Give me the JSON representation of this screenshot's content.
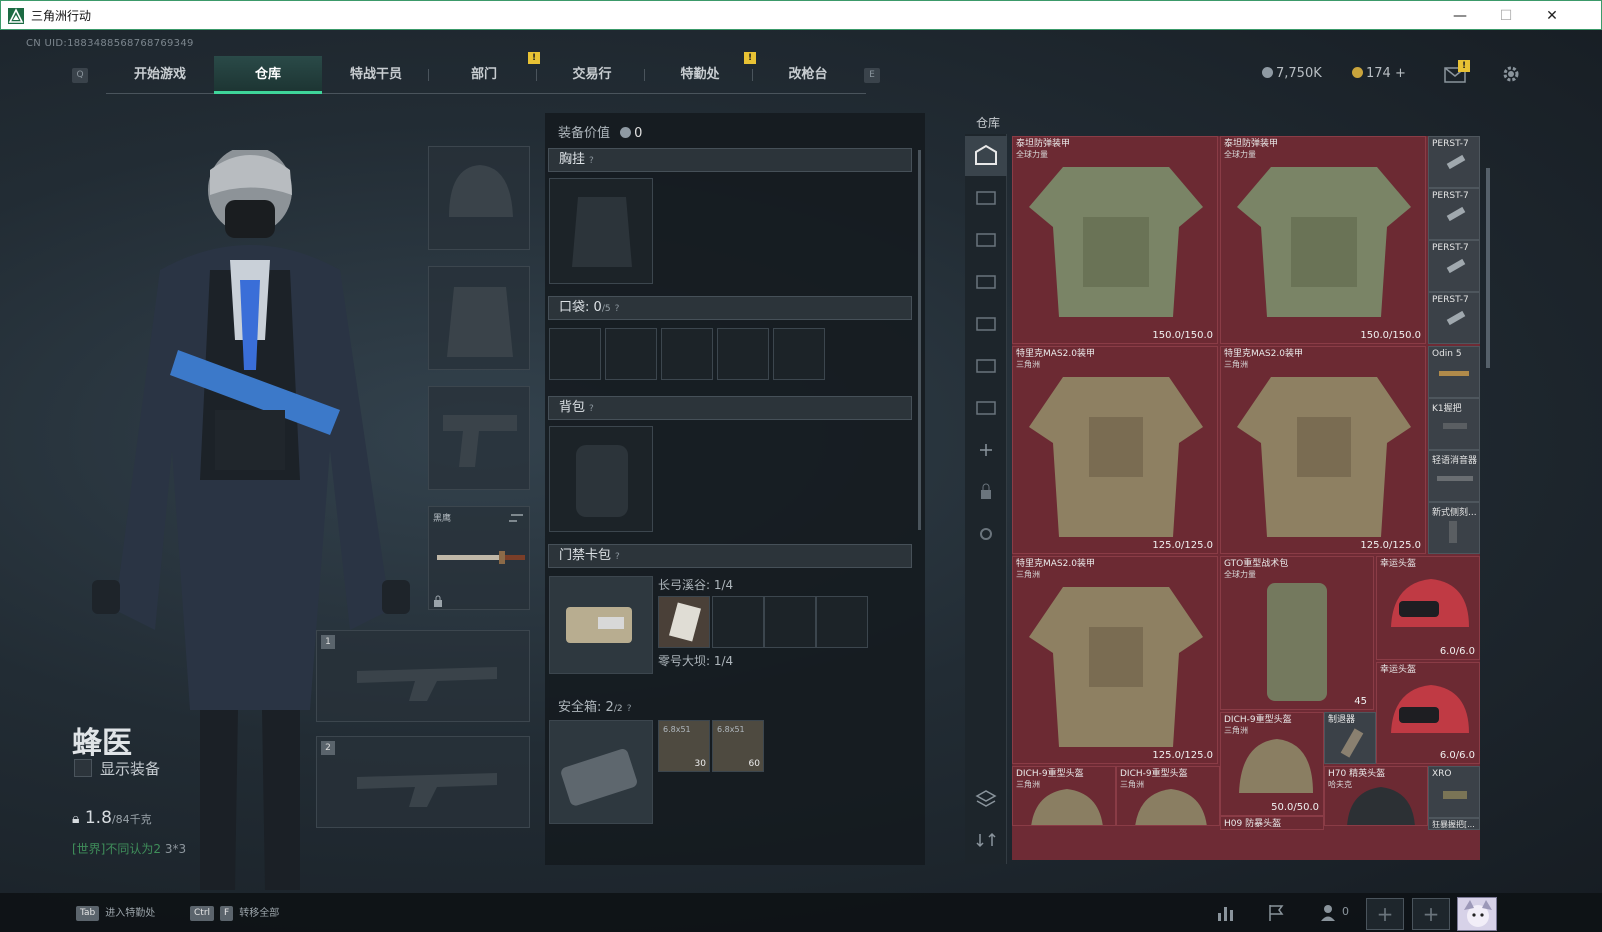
{
  "window": {
    "title": "三角洲行动",
    "min": "—",
    "max": "☐",
    "close": "✕"
  },
  "uid": "CN UID:1883488568768769349",
  "nav": {
    "left_key": "Q",
    "right_key": "E",
    "tabs": [
      {
        "label": "开始游戏"
      },
      {
        "label": "仓库"
      },
      {
        "label": "特战干员"
      },
      {
        "label": "部门"
      },
      {
        "label": "交易行"
      },
      {
        "label": "特勤处"
      },
      {
        "label": "改枪台"
      }
    ],
    "active_tab": 1,
    "notif_mark": "!"
  },
  "currency": {
    "silver": "7,750K",
    "gold": "174 +"
  },
  "operator": {
    "name": "蜂医",
    "show_equip": "显示装备",
    "weight": "1.8",
    "weight_max": "/84千克"
  },
  "chat": {
    "channel": "[世界]",
    "text": "不同认为2",
    "text2": "3*3"
  },
  "loadout": {
    "melee_label": "黑鹰",
    "weapon1_num": "1",
    "weapon2_num": "2"
  },
  "middle": {
    "value_label": "装备价值",
    "value": "0",
    "chest_label": "胸挂",
    "pocket_label": "口袋:",
    "pocket_count": "0",
    "pocket_max": "/5",
    "backpack_label": "背包",
    "keycard_label": "门禁卡包",
    "keycard_area1": "长弓溪谷: 1/4",
    "keycard_area2": "零号大坝: 1/4",
    "safebox_label": "安全箱:",
    "safebox_count": "2",
    "safebox_max": "/2",
    "ammo1_name": "6.8x51",
    "ammo1_count": "30",
    "ammo2_name": "6.8x51",
    "ammo2_count": "60",
    "help": "?"
  },
  "inventory": {
    "title": "仓库",
    "items": [
      {
        "name": "泰坦防弹装甲",
        "sub": "全球力量",
        "dur": "150.0/150.0"
      },
      {
        "name": "泰坦防弹装甲",
        "sub": "全球力量",
        "dur": "150.0/150.0"
      },
      {
        "name": "特里克MAS2.0装甲",
        "sub": "三角洲",
        "dur": "125.0/125.0"
      },
      {
        "name": "特里克MAS2.0装甲",
        "sub": "三角洲",
        "dur": "125.0/125.0"
      },
      {
        "name": "特里克MAS2.0装甲",
        "sub": "三角洲",
        "dur": "125.0/125.0"
      },
      {
        "name": "GTO重型战术包",
        "sub": "全球力量",
        "dur": ""
      },
      {
        "name": "幸运头盔",
        "sub": "",
        "dur": "6.0/6.0"
      },
      {
        "name": "幸运头盔",
        "sub": "",
        "dur": "6.0/6.0"
      },
      {
        "name": "DICH-9重型头盔",
        "sub": "三角洲",
        "dur": "50.0/50.0"
      },
      {
        "name": "制退器",
        "sub": "",
        "dur": ""
      },
      {
        "name": "DICH-9重型头盔",
        "sub": "三角洲",
        "dur": ""
      },
      {
        "name": "DICH-9重型头盔",
        "sub": "三角洲",
        "dur": ""
      },
      {
        "name": "H70 精英头盔",
        "sub": "哈夫克",
        "dur": ""
      },
      {
        "name": "H09 防暴头盔",
        "sub": "",
        "dur": ""
      }
    ],
    "gto_count": "45",
    "small_items": [
      "PERST-7",
      "PERST-7",
      "PERST-7",
      "PERST-7",
      "Odin 5",
      "K1握把",
      "轻语消音器",
      "新式侧刻...",
      "XRO",
      "狂暴握把[..."
    ]
  },
  "bottom": {
    "tab_key": "Tab",
    "tab_action": "进入特勤处",
    "ctrl_key": "Ctrl",
    "f_key": "F",
    "ctrl_action": "转移全部",
    "friends_count": "0"
  }
}
